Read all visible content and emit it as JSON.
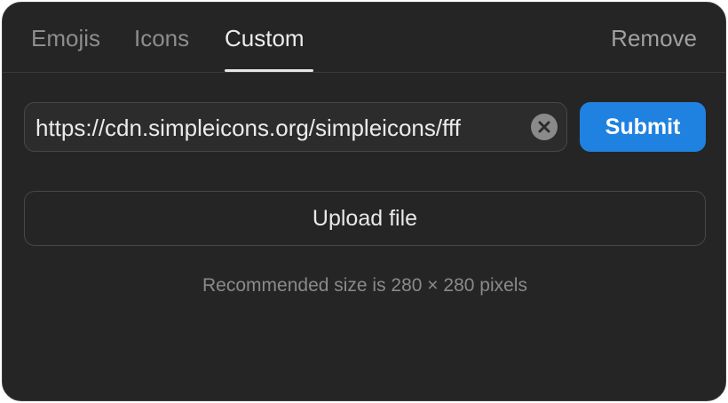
{
  "tabs": [
    {
      "label": "Emojis",
      "active": false
    },
    {
      "label": "Icons",
      "active": false
    },
    {
      "label": "Custom",
      "active": true
    }
  ],
  "header": {
    "remove_label": "Remove"
  },
  "url_input": {
    "value": "https://cdn.simpleicons.org/simpleicons/fff",
    "clear_icon": "clear-icon"
  },
  "submit": {
    "label": "Submit"
  },
  "upload": {
    "label": "Upload file"
  },
  "hint": "Recommended size is 280 × 280 pixels",
  "colors": {
    "panel_bg": "#252525",
    "accent": "#1f82e0",
    "text_primary": "#ececec",
    "text_muted": "#8a8a8a"
  }
}
